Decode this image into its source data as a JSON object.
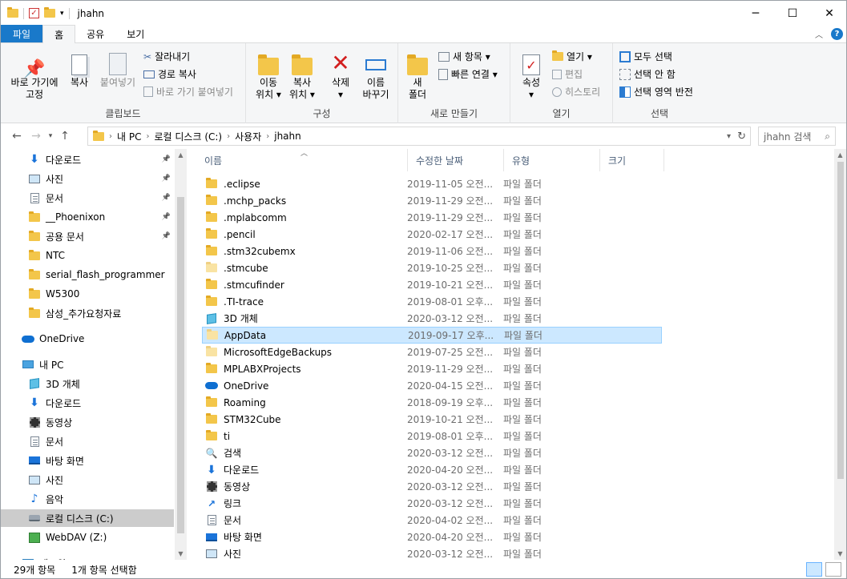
{
  "window": {
    "title": "jhahn",
    "minimize": "─",
    "maximize": "☐",
    "close": "✕"
  },
  "tabs": [
    "파일",
    "홈",
    "공유",
    "보기"
  ],
  "ribbon": {
    "clipboard": {
      "label": "클립보드",
      "pin": "바로 가기에\n고정",
      "copy": "복사",
      "paste": "붙여넣기",
      "cut": "잘라내기",
      "copy_path": "경로 복사",
      "paste_shortcut": "바로 가기 붙여넣기"
    },
    "organize": {
      "label": "구성",
      "move": "이동\n위치 ▾",
      "copyto": "복사\n위치 ▾",
      "delete": "삭제\n▾",
      "rename": "이름\n바꾸기"
    },
    "new": {
      "label": "새로 만들기",
      "new_folder": "새\n폴더",
      "new_item": "새 항목 ▾",
      "easy_access": "빠른 연결 ▾"
    },
    "open": {
      "label": "열기",
      "properties": "속성\n▾",
      "open": "열기 ▾",
      "edit": "편집",
      "history": "히스토리"
    },
    "select": {
      "label": "선택",
      "all": "모두 선택",
      "none": "선택 안 함",
      "invert": "선택 영역 반전"
    }
  },
  "address": {
    "crumbs": [
      "내 PC",
      "로컬 디스크 (C:)",
      "사용자",
      "jhahn"
    ],
    "search_placeholder": "jhahn 검색"
  },
  "nav": [
    {
      "label": "다운로드",
      "icon": "download-icon",
      "pin": true
    },
    {
      "label": "사진",
      "icon": "pictures-icon",
      "pin": true
    },
    {
      "label": "문서",
      "icon": "document-icon",
      "pin": true
    },
    {
      "label": "__Phoenixon",
      "icon": "folder-icon",
      "pin": true
    },
    {
      "label": "공용 문서",
      "icon": "folder-icon",
      "pin": true
    },
    {
      "label": "NTC",
      "icon": "folder-icon"
    },
    {
      "label": "serial_flash_programmer",
      "icon": "folder-icon"
    },
    {
      "label": "W5300",
      "icon": "folder-icon"
    },
    {
      "label": "삼성_추가요청자료",
      "icon": "folder-icon"
    },
    {
      "label": "OneDrive",
      "icon": "onedrive-icon"
    },
    {
      "label": "내 PC",
      "icon": "pc-icon"
    },
    {
      "label": "3D 개체",
      "icon": "3d-icon"
    },
    {
      "label": "다운로드",
      "icon": "download-icon"
    },
    {
      "label": "동영상",
      "icon": "video-icon"
    },
    {
      "label": "문서",
      "icon": "document-icon"
    },
    {
      "label": "바탕 화면",
      "icon": "desktop-icon"
    },
    {
      "label": "사진",
      "icon": "pictures-icon"
    },
    {
      "label": "음악",
      "icon": "music-icon"
    },
    {
      "label": "로컬 디스크 (C:)",
      "icon": "drive-icon",
      "selected": true
    },
    {
      "label": "WebDAV (Z:)",
      "icon": "webdav-icon"
    },
    {
      "label": "네트워크",
      "icon": "network-icon"
    }
  ],
  "columns": [
    "이름",
    "수정한 날짜",
    "유형",
    "크기"
  ],
  "files": [
    {
      "name": ".eclipse",
      "date": "2019-11-05 오전...",
      "type": "파일 폴더",
      "icon": "folder-icon"
    },
    {
      "name": ".mchp_packs",
      "date": "2019-11-29 오전...",
      "type": "파일 폴더",
      "icon": "folder-icon"
    },
    {
      "name": ".mplabcomm",
      "date": "2019-11-29 오전...",
      "type": "파일 폴더",
      "icon": "folder-icon"
    },
    {
      "name": ".pencil",
      "date": "2020-02-17 오전...",
      "type": "파일 폴더",
      "icon": "folder-icon"
    },
    {
      "name": ".stm32cubemx",
      "date": "2019-11-06 오전...",
      "type": "파일 폴더",
      "icon": "folder-icon"
    },
    {
      "name": ".stmcube",
      "date": "2019-10-25 오전...",
      "type": "파일 폴더",
      "icon": "folder-icon-pale"
    },
    {
      "name": ".stmcufinder",
      "date": "2019-10-21 오전...",
      "type": "파일 폴더",
      "icon": "folder-icon"
    },
    {
      "name": ".TI-trace",
      "date": "2019-08-01 오후...",
      "type": "파일 폴더",
      "icon": "folder-icon"
    },
    {
      "name": "3D 개체",
      "date": "2020-03-12 오전...",
      "type": "파일 폴더",
      "icon": "3d-icon"
    },
    {
      "name": "AppData",
      "date": "2019-09-17 오후...",
      "type": "파일 폴더",
      "icon": "folder-icon-pale",
      "selected": true
    },
    {
      "name": "MicrosoftEdgeBackups",
      "date": "2019-07-25 오전...",
      "type": "파일 폴더",
      "icon": "folder-icon-pale"
    },
    {
      "name": "MPLABXProjects",
      "date": "2019-11-29 오전...",
      "type": "파일 폴더",
      "icon": "folder-icon"
    },
    {
      "name": "OneDrive",
      "date": "2020-04-15 오전...",
      "type": "파일 폴더",
      "icon": "onedrive-icon"
    },
    {
      "name": "Roaming",
      "date": "2018-09-19 오후...",
      "type": "파일 폴더",
      "icon": "folder-icon"
    },
    {
      "name": "STM32Cube",
      "date": "2019-10-21 오전...",
      "type": "파일 폴더",
      "icon": "folder-icon"
    },
    {
      "name": "ti",
      "date": "2019-08-01 오후...",
      "type": "파일 폴더",
      "icon": "folder-icon"
    },
    {
      "name": "검색",
      "date": "2020-03-12 오전...",
      "type": "파일 폴더",
      "icon": "search-folder-icon"
    },
    {
      "name": "다운로드",
      "date": "2020-04-20 오전...",
      "type": "파일 폴더",
      "icon": "download-icon"
    },
    {
      "name": "동영상",
      "date": "2020-03-12 오전...",
      "type": "파일 폴더",
      "icon": "video-icon"
    },
    {
      "name": "링크",
      "date": "2020-03-12 오전...",
      "type": "파일 폴더",
      "icon": "link-icon"
    },
    {
      "name": "문서",
      "date": "2020-04-02 오전...",
      "type": "파일 폴더",
      "icon": "document-icon"
    },
    {
      "name": "바탕 화면",
      "date": "2020-04-20 오전...",
      "type": "파일 폴더",
      "icon": "desktop-icon"
    },
    {
      "name": "사진",
      "date": "2020-03-12 오전...",
      "type": "파일 폴더",
      "icon": "pictures-icon"
    }
  ],
  "status": {
    "count": "29개 항목",
    "selected": "1개 항목 선택함"
  }
}
